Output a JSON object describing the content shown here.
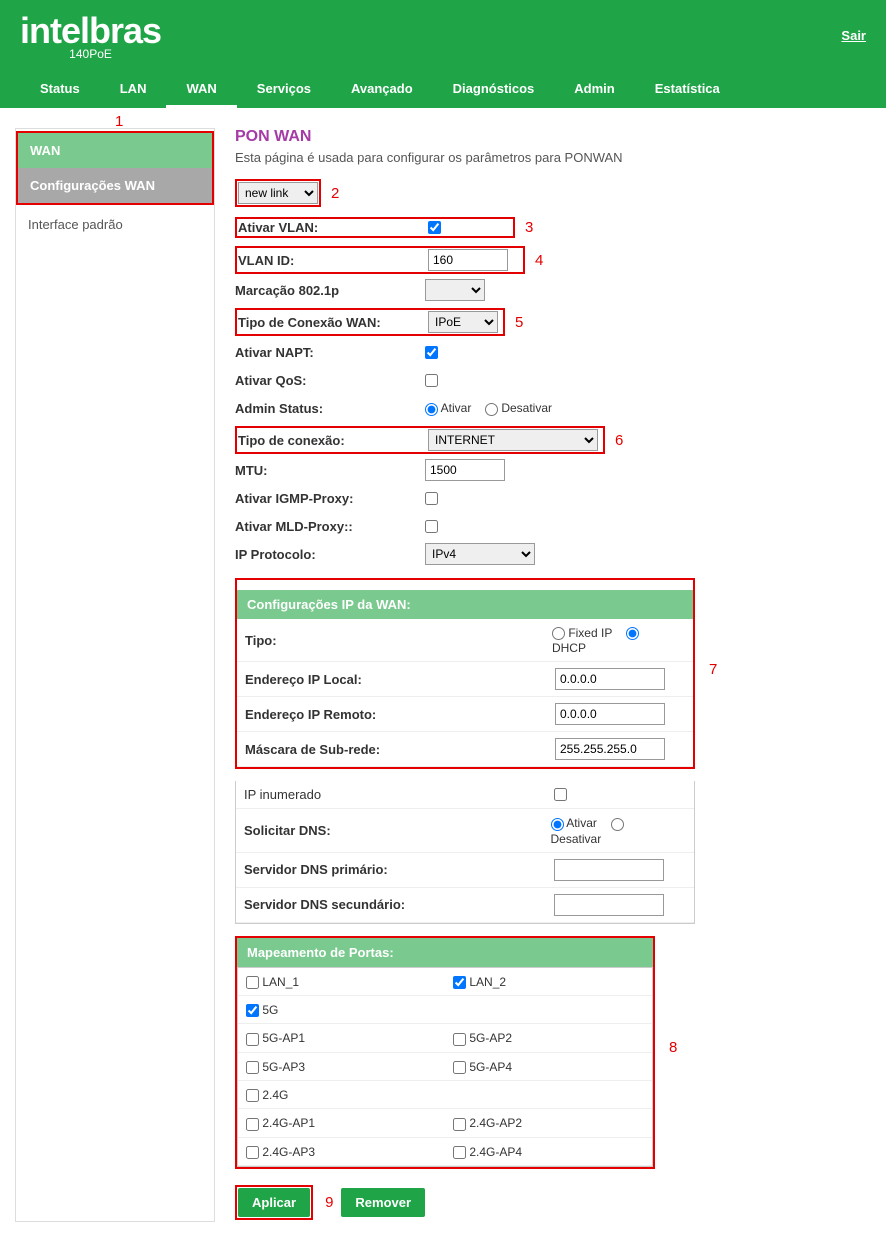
{
  "header": {
    "brand": "intelbras",
    "model": "140PoE",
    "logout": "Sair"
  },
  "nav": [
    "Status",
    "LAN",
    "WAN",
    "Serviços",
    "Avançado",
    "Diagnósticos",
    "Admin",
    "Estatística"
  ],
  "sidebar": {
    "wan": "WAN",
    "config": "Configurações WAN",
    "iface": "Interface padrão"
  },
  "page": {
    "title": "PON WAN",
    "desc": "Esta página é usada para configurar os parâmetros para PONWAN"
  },
  "annotations": {
    "n1": "1",
    "n2": "2",
    "n3": "3",
    "n4": "4",
    "n5": "5",
    "n6": "6",
    "n7": "7",
    "n8": "8",
    "n9": "9"
  },
  "form": {
    "link_value": "new link",
    "vlan_label": "Ativar VLAN:",
    "vlan_id_label": "VLAN ID:",
    "vlan_id_value": "160",
    "marc_label": "Marcação 802.1p",
    "conn_type_label": "Tipo de Conexão WAN:",
    "conn_type_value": "IPoE",
    "napt_label": "Ativar NAPT:",
    "qos_label": "Ativar QoS:",
    "admin_label": "Admin Status:",
    "admin_on": "Ativar",
    "admin_off": "Desativar",
    "conn_kind_label": "Tipo de conexão:",
    "conn_kind_value": "INTERNET",
    "mtu_label": "MTU:",
    "mtu_value": "1500",
    "igmp_label": "Ativar IGMP-Proxy:",
    "mld_label": "Ativar MLD-Proxy::",
    "ipproto_label": "IP Protocolo:",
    "ipproto_value": "IPv4"
  },
  "ip": {
    "header": "Configurações IP da WAN:",
    "tipo": "Tipo:",
    "fixed": "Fixed IP",
    "dhcp": "DHCP",
    "local": "Endereço IP Local:",
    "local_v": "0.0.0.0",
    "remote": "Endereço IP Remoto:",
    "remote_v": "0.0.0.0",
    "mask": "Máscara de Sub-rede:",
    "mask_v": "255.255.255.0",
    "inum": "IP inumerado",
    "dns_req": "Solicitar DNS:",
    "dns_on": "Ativar",
    "dns_off": "Desativar",
    "dns1": "Servidor DNS primário:",
    "dns2": "Servidor DNS secundário:"
  },
  "ports": {
    "header": "Mapeamento de Portas:",
    "lan1": "LAN_1",
    "lan2": "LAN_2",
    "g5": "5G",
    "g5ap1": "5G-AP1",
    "g5ap2": "5G-AP2",
    "g5ap3": "5G-AP3",
    "g5ap4": "5G-AP4",
    "g24": "2.4G",
    "g24ap1": "2.4G-AP1",
    "g24ap2": "2.4G-AP2",
    "g24ap3": "2.4G-AP3",
    "g24ap4": "2.4G-AP4"
  },
  "buttons": {
    "apply": "Aplicar",
    "remove": "Remover"
  }
}
